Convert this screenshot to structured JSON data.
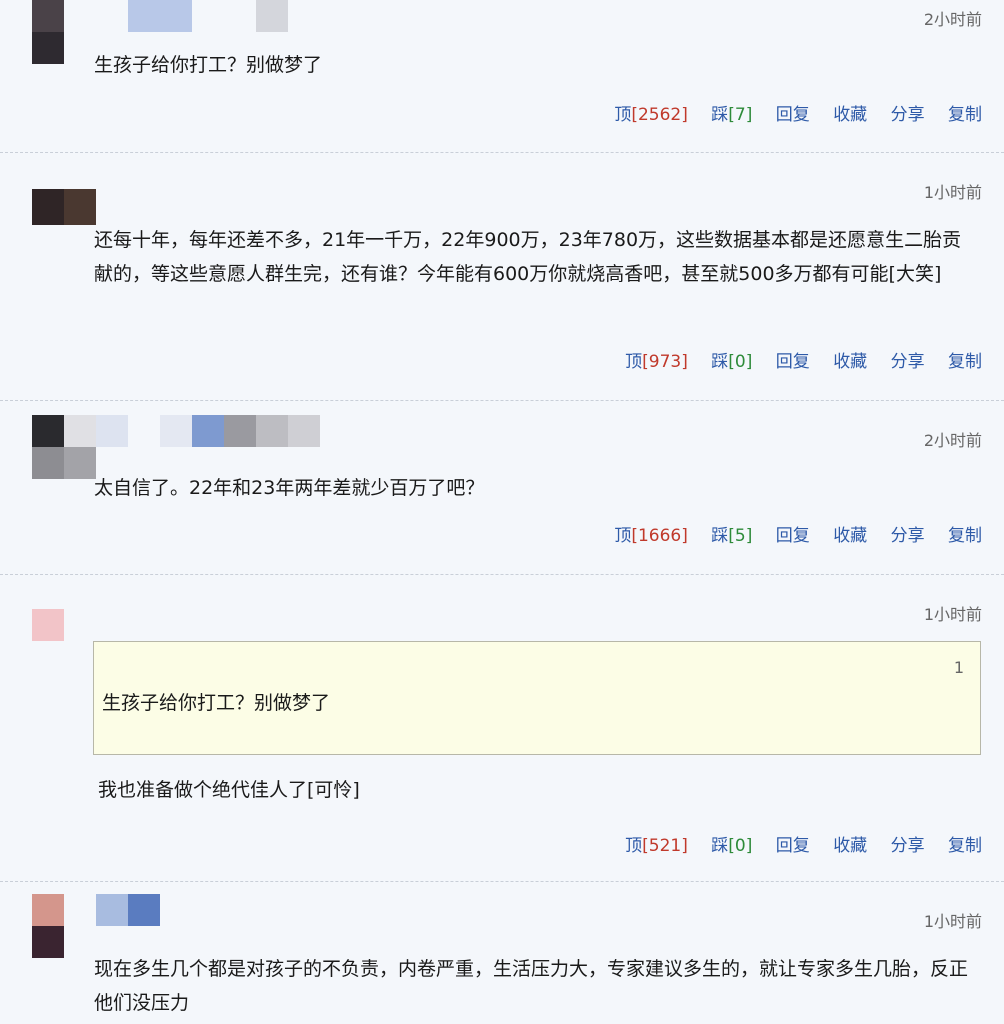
{
  "comments": [
    {
      "time": "2小时前",
      "text": "生孩子给你打工？别做梦了",
      "up_label": "顶",
      "up_count": "[2562]",
      "down_label": "踩",
      "down_count": "[7]",
      "reply": "回复",
      "fav": "收藏",
      "share": "分享",
      "copy": "复制"
    },
    {
      "time": "1小时前",
      "text": "还每十年，每年还差不多，21年一千万，22年900万，23年780万，这些数据基本都是还愿意生二胎贡献的，等这些意愿人群生完，还有谁？今年能有600万你就烧高香吧，甚至就500多万都有可能[大笑]",
      "up_label": "顶",
      "up_count": "[973]",
      "down_label": "踩",
      "down_count": "[0]",
      "reply": "回复",
      "fav": "收藏",
      "share": "分享",
      "copy": "复制"
    },
    {
      "time": "2小时前",
      "text": "太自信了。22年和23年两年差就少百万了吧？",
      "up_label": "顶",
      "up_count": "[1666]",
      "down_label": "踩",
      "down_count": "[5]",
      "reply": "回复",
      "fav": "收藏",
      "share": "分享",
      "copy": "复制"
    },
    {
      "time": "1小时前",
      "quote_num": "1",
      "quote_text": "生孩子给你打工？别做梦了",
      "text": "我也准备做个绝代佳人了[可怜]",
      "up_label": "顶",
      "up_count": "[521]",
      "down_label": "踩",
      "down_count": "[0]",
      "reply": "回复",
      "fav": "收藏",
      "share": "分享",
      "copy": "复制"
    },
    {
      "time": "1小时前",
      "text": "现在多生几个都是对孩子的不负责，内卷严重，生活压力大，专家建议多生的，就让专家多生几胎，反正他们没压力"
    }
  ],
  "colors": {
    "link": "#2e5aa8",
    "up": "#c0392b",
    "down": "#2e8b3a",
    "quote_bg": "#fcfde6"
  }
}
